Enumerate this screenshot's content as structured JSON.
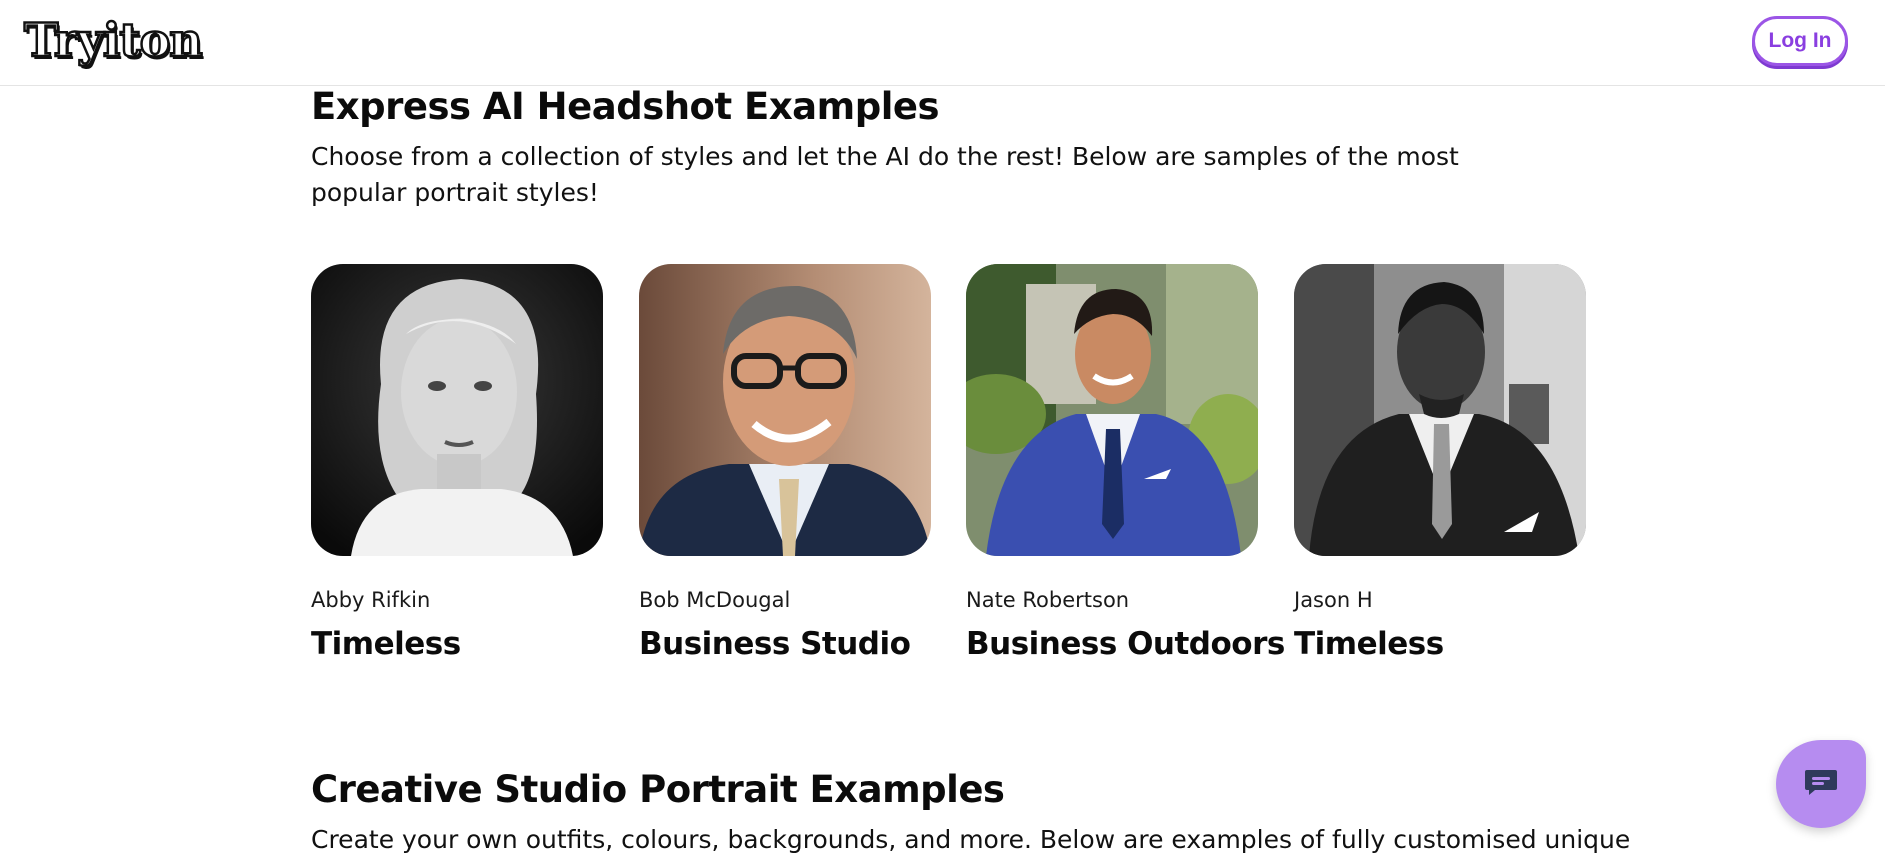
{
  "header": {
    "logo_text": "Tryiton",
    "login_label": "Log In"
  },
  "express": {
    "title": "Express AI Headshot Examples",
    "description": "Choose from a collection of styles and let the AI do the rest! Below are samples of the most popular portrait styles!",
    "cards": [
      {
        "name": "Abby Rifkin",
        "style": "Timeless"
      },
      {
        "name": "Bob McDougal",
        "style": "Business Studio"
      },
      {
        "name": "Nate Robertson",
        "style": "Business Outdoors"
      },
      {
        "name": "Jason H",
        "style": "Timeless"
      }
    ]
  },
  "creative": {
    "title": "Creative Studio Portrait Examples",
    "description": "Create your own outfits, colours, backgrounds, and more. Below are examples of fully customised unique"
  },
  "chat": {
    "icon": "chat-icon",
    "color": "#b68cf0"
  },
  "colors": {
    "accent": "#9b55e6"
  }
}
